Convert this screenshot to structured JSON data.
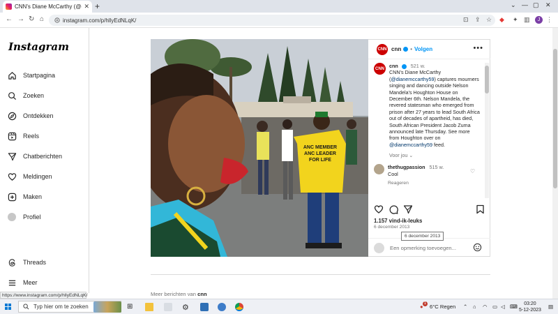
{
  "browser": {
    "tab_title": "CNN's Diane McCarthy (@diane",
    "url": "instagram.com/p/hllyEdNLqK/",
    "profile_initial": "J"
  },
  "sidebar": {
    "logo": "Instagram",
    "items": [
      {
        "label": "Startpagina",
        "icon": "home-icon"
      },
      {
        "label": "Zoeken",
        "icon": "search-icon"
      },
      {
        "label": "Ontdekken",
        "icon": "compass-icon"
      },
      {
        "label": "Reels",
        "icon": "reels-icon"
      },
      {
        "label": "Chatberichten",
        "icon": "messenger-icon"
      },
      {
        "label": "Meldingen",
        "icon": "heart-icon"
      },
      {
        "label": "Maken",
        "icon": "plus-square-icon"
      },
      {
        "label": "Profiel",
        "icon": "avatar-icon"
      },
      {
        "label": "Threads",
        "icon": "threads-icon"
      },
      {
        "label": "Meer",
        "icon": "menu-icon"
      }
    ]
  },
  "post": {
    "username": "cnn",
    "follow_label": "Volgen",
    "separator": "•",
    "caption_time": "521 w.",
    "caption_parts": [
      "CNN's Diane McCarthy (",
      "@dianemccarthy59",
      ") captures mourners singing and dancing outside Nelson Mandela's Houghton House on December 6th. Nelson Mandela, the revered statesman who emerged from prison after 27 years to lead South Africa out of decades of apartheid, has died, South African President Jacob Zuma announced late Thursday. See more from Houghton over on ",
      "@dianemccarthy59",
      " feed."
    ],
    "voor_jou": "Voor jou",
    "comment": {
      "username": "thethugpassion",
      "time": "515 w.",
      "text": "Cool",
      "reply_label": "Reageren"
    },
    "likes": "1.157 vind-ik-leuks",
    "date": "6 december 2013",
    "date_tooltip": "6 december 2013",
    "add_comment_placeholder": "Een opmerking toevoegen..."
  },
  "photo": {
    "shirt_line1": "ANC MEMBER",
    "shirt_line2": "ANC LEADER",
    "shirt_line3": "FOR LIFE"
  },
  "more_from": {
    "prefix": "Meer berichten van",
    "user": "cnn"
  },
  "status_url": "https://www.instagram.com/p/hllyEdNLqK/",
  "taskbar": {
    "search_placeholder": "Typ hier om te zoeken",
    "weather": "6°C  Regen",
    "time": "03:20",
    "date": "5-12-2023",
    "notification_count": "1"
  },
  "colors": {
    "link": "#0095f6",
    "cnn_red": "#cc0000",
    "windows_blue": "#0078d4"
  }
}
